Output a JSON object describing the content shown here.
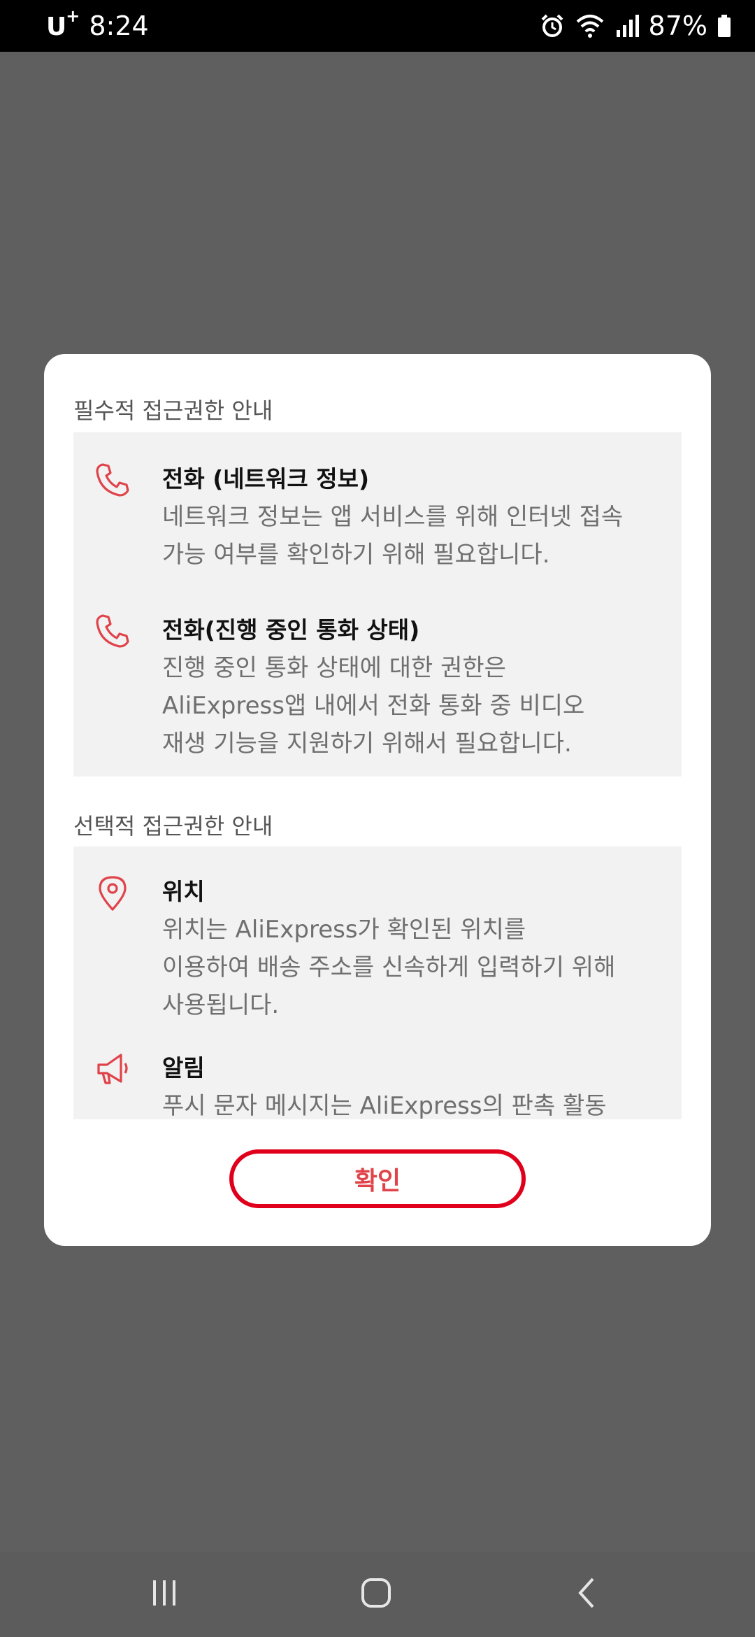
{
  "status_bar": {
    "carrier": "U",
    "carrier_sup": "+",
    "time": "8:24",
    "battery": "87%",
    "icons": [
      "alarm-icon",
      "wifi-icon",
      "signal-icon",
      "battery-icon"
    ]
  },
  "dialog": {
    "required_section_title": "필수적 접근권한 안내",
    "required_items": [
      {
        "icon": "phone-icon",
        "title": "전화 (네트워크 정보)",
        "description": "네트워크 정보는 앱 서비스를 위해 인터넷 접속\n가능 여부를 확인하기 위해 필요합니다."
      },
      {
        "icon": "phone-icon",
        "title": "전화(진행 중인 통화 상태)",
        "description": "진행 중인 통화 상태에 대한 권한은\nAliExpress앱 내에서 전화 통화 중 비디오\n재생 기능을 지원하기 위해서 필요합니다."
      }
    ],
    "optional_section_title": "선택적 접근권한 안내",
    "optional_items": [
      {
        "icon": "location-pin-icon",
        "title": "위치",
        "description": "위치는 AliExpress가 확인된 위치를\n이용하여 배송 주소를 신속하게 입력하기 위해\n사용됩니다."
      },
      {
        "icon": "megaphone-icon",
        "title": "알림",
        "description": "푸시 문자 메시지는 AliExpress의 판촉 활동"
      }
    ],
    "confirm_label": "확인"
  },
  "nav_bar": {
    "icons": [
      "recent-apps-icon",
      "home-icon",
      "back-icon"
    ]
  },
  "colors": {
    "accent": "#e0434a",
    "button_border": "#e0001c",
    "overlay": "#5f5f5f",
    "panel": "#f2f2f2"
  }
}
